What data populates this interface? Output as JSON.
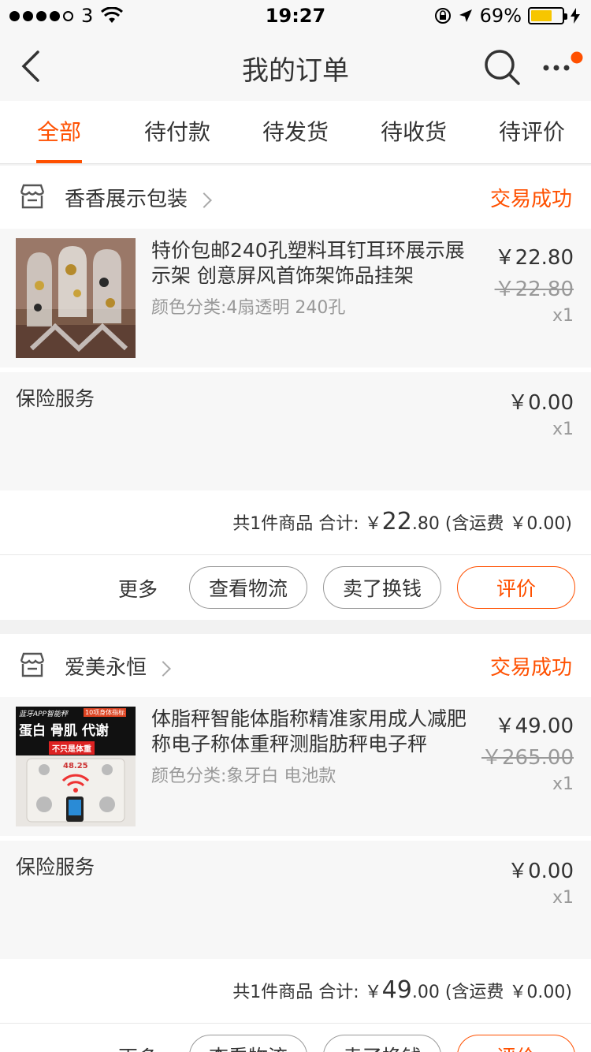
{
  "status_bar": {
    "carrier": "3",
    "time": "19:27",
    "battery": "69%",
    "battery_level": 0.69
  },
  "nav": {
    "title": "我的订单"
  },
  "tabs": [
    {
      "label": "全部",
      "active": true
    },
    {
      "label": "待付款",
      "active": false
    },
    {
      "label": "待发货",
      "active": false
    },
    {
      "label": "待收货",
      "active": false
    },
    {
      "label": "待评价",
      "active": false
    }
  ],
  "orders": [
    {
      "shop": "香香展示包装",
      "status": "交易成功",
      "item": {
        "title": "特价包邮240孔塑料耳钉耳环展示展示架 创意屏风首饰架饰品挂架",
        "sku": "颜色分类:4扇透明 240孔",
        "price": "￥22.80",
        "orig_price": "￥22.80",
        "qty": "x1"
      },
      "service": {
        "name": "保险服务",
        "price": "￥0.00",
        "qty": "x1"
      },
      "summary": {
        "prefix": "共1件商品 合计: ￥",
        "int": "22",
        "dec": ".80",
        "suffix": " (含运费 ￥0.00)"
      },
      "actions": {
        "more": "更多",
        "logistics": "查看物流",
        "resell": "卖了换钱",
        "review": "评价"
      }
    },
    {
      "shop": "爱美永恒",
      "status": "交易成功",
      "item": {
        "title": "体脂秤智能体脂称精准家用成人减肥称电子称体重秤测脂肪秤电子秤",
        "sku": "颜色分类:象牙白 电池款",
        "price": "￥49.00",
        "orig_price": "￥265.00",
        "qty": "x1",
        "thumb_text": {
          "top": "蓝牙APP智能秤",
          "tag": "10项身体指标",
          "headline": "蛋白 骨肌 代谢",
          "sub": "不只是体重",
          "display": "48.25"
        }
      },
      "service": {
        "name": "保险服务",
        "price": "￥0.00",
        "qty": "x1"
      },
      "summary": {
        "prefix": "共1件商品 合计: ￥",
        "int": "49",
        "dec": ".00",
        "suffix": " (含运费 ￥0.00)"
      },
      "actions": {
        "more": "更多",
        "logistics": "查看物流",
        "resell": "卖了换钱",
        "review": "评价"
      }
    }
  ],
  "colors": {
    "accent": "#ff5000",
    "bg": "#f2f2f2",
    "card": "#f7f7f7"
  }
}
